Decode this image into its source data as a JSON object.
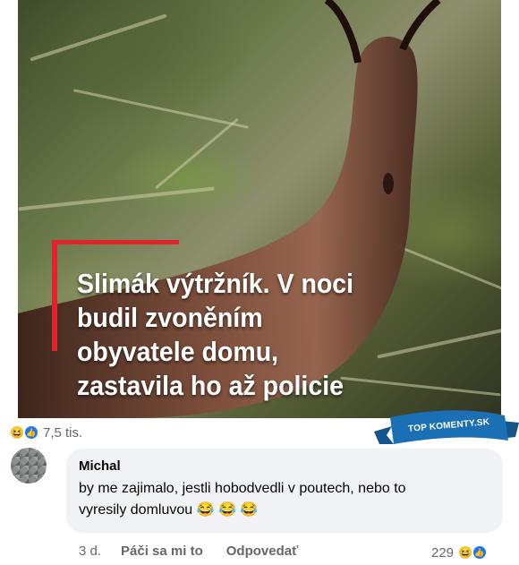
{
  "post": {
    "image_headline": [
      "Slimák výtržník. V noci",
      "budil zvoněním",
      "obyvatele domu,",
      "zastavila ho až policie"
    ],
    "reaction_count": "7,5 tis.",
    "reaction_icons": [
      "haha-icon",
      "like-icon"
    ]
  },
  "badge": {
    "label": "TOP KOMENTY.SK",
    "color": "#1b6fb5"
  },
  "comment": {
    "author": "Michal",
    "text_line1": "by me zajimalo, jestli hobodvedli v poutech, nebo to",
    "text_line2": "vyresily domluvou",
    "emojis": [
      "😂",
      "😂",
      "😂"
    ],
    "time": "3 d.",
    "like_label": "Páči sa mi to",
    "reply_label": "Odpovedať",
    "reaction_count": "229",
    "reaction_icons": [
      "haha-icon",
      "like-icon"
    ]
  },
  "colors": {
    "accent_red": "#e2232a",
    "facebook_blue": "#1877f2",
    "bubble_bg": "#f0f2f5",
    "muted_text": "#65676b"
  }
}
